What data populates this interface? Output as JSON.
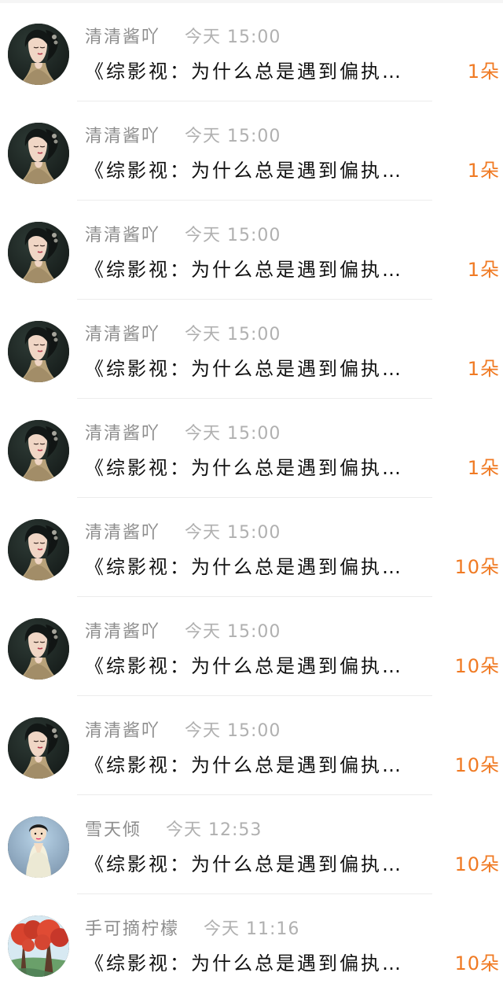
{
  "items": [
    {
      "username": "清清酱吖",
      "time": "今天 15:00",
      "content": "《综影视：为什么总是遇到偏执…",
      "count": "1朵",
      "avatar_icon": "woman-portrait-avatar"
    },
    {
      "username": "清清酱吖",
      "time": "今天 15:00",
      "content": "《综影视：为什么总是遇到偏执…",
      "count": "1朵",
      "avatar_icon": "woman-portrait-avatar"
    },
    {
      "username": "清清酱吖",
      "time": "今天 15:00",
      "content": "《综影视：为什么总是遇到偏执…",
      "count": "1朵",
      "avatar_icon": "woman-portrait-avatar"
    },
    {
      "username": "清清酱吖",
      "time": "今天 15:00",
      "content": "《综影视：为什么总是遇到偏执…",
      "count": "1朵",
      "avatar_icon": "woman-portrait-avatar"
    },
    {
      "username": "清清酱吖",
      "time": "今天 15:00",
      "content": "《综影视：为什么总是遇到偏执…",
      "count": "1朵",
      "avatar_icon": "woman-portrait-avatar"
    },
    {
      "username": "清清酱吖",
      "time": "今天 15:00",
      "content": "《综影视：为什么总是遇到偏执…",
      "count": "10朵",
      "avatar_icon": "woman-portrait-avatar"
    },
    {
      "username": "清清酱吖",
      "time": "今天 15:00",
      "content": "《综影视：为什么总是遇到偏执…",
      "count": "10朵",
      "avatar_icon": "woman-portrait-avatar"
    },
    {
      "username": "清清酱吖",
      "time": "今天 15:00",
      "content": "《综影视：为什么总是遇到偏执…",
      "count": "10朵",
      "avatar_icon": "woman-portrait-avatar"
    },
    {
      "username": "雪天倾",
      "time": "今天 12:53",
      "content": "《综影视：为什么总是遇到偏执…",
      "count": "10朵",
      "avatar_icon": "white-dress-avatar"
    },
    {
      "username": "手可摘柠檬",
      "time": "今天 11:16",
      "content": "《综影视：为什么总是遇到偏执…",
      "count": "10朵",
      "avatar_icon": "red-flowers-avatar"
    }
  ],
  "colors": {
    "count": "#f07a23",
    "meta": "#9a9a9a",
    "content": "#111111",
    "divider": "#ececec"
  }
}
